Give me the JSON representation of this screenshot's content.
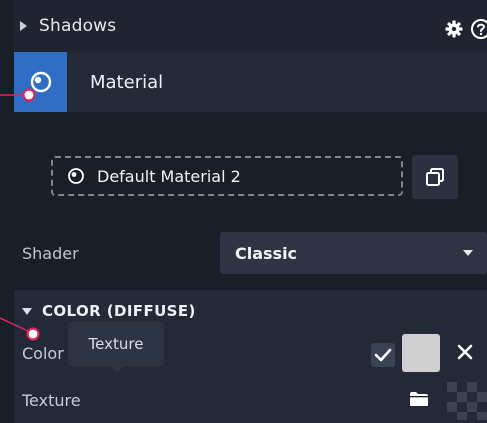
{
  "shadows": {
    "label": "Shadows"
  },
  "material": {
    "title": "Material"
  },
  "default_material": {
    "name": "Default Material 2"
  },
  "shader": {
    "label": "Shader",
    "value": "Classic"
  },
  "color_section": {
    "header": "COLOR (DIFFUSE)"
  },
  "color": {
    "label": "Color",
    "swatch": "#cfcfcf",
    "enabled": true
  },
  "tooltip": {
    "text": "Texture"
  },
  "texture": {
    "label": "Texture"
  },
  "colors": {
    "accent": "#2f6ec4",
    "annotation": "#e0245e",
    "panel_bg": "#1a1e27"
  }
}
